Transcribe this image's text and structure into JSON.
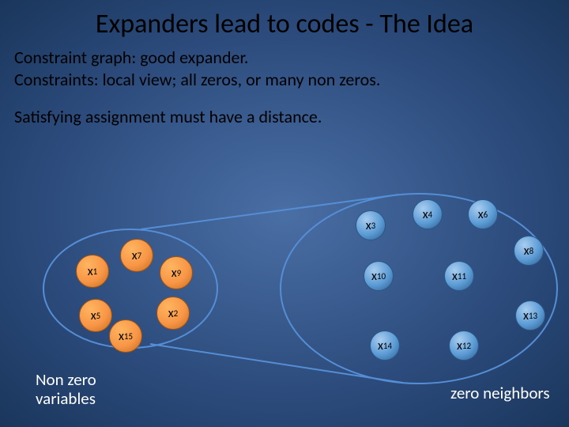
{
  "title": "Expanders lead to codes - The Idea",
  "lines": {
    "l1": "Constraint graph: good expander.",
    "l2": "Constraints: local view; all zeros, or many non zeros.",
    "l3": "Satisfying assignment must have a distance."
  },
  "captions": {
    "left": "Non zero\nvariables",
    "right": "zero neighbors"
  },
  "nodes": {
    "x1": {
      "var": "x",
      "sub": "1"
    },
    "x7": {
      "var": "x",
      "sub": "7"
    },
    "x9": {
      "var": "x",
      "sub": "9"
    },
    "x5": {
      "var": "x",
      "sub": "5"
    },
    "x2": {
      "var": "x",
      "sub": "2"
    },
    "x15": {
      "var": "x",
      "sub": "15"
    },
    "x3": {
      "var": "x",
      "sub": "3"
    },
    "x4": {
      "var": "x",
      "sub": "4"
    },
    "x6": {
      "var": "x",
      "sub": "6"
    },
    "x8": {
      "var": "x",
      "sub": "8"
    },
    "x10": {
      "var": "x",
      "sub": "10"
    },
    "x11": {
      "var": "x",
      "sub": "11"
    },
    "x13": {
      "var": "x",
      "sub": "13"
    },
    "x14": {
      "var": "x",
      "sub": "14"
    },
    "x12": {
      "var": "x",
      "sub": "12"
    }
  },
  "colors": {
    "orange": "#f79646",
    "blue": "#5b9bd5",
    "ellipse_stroke": "#558ed5"
  }
}
